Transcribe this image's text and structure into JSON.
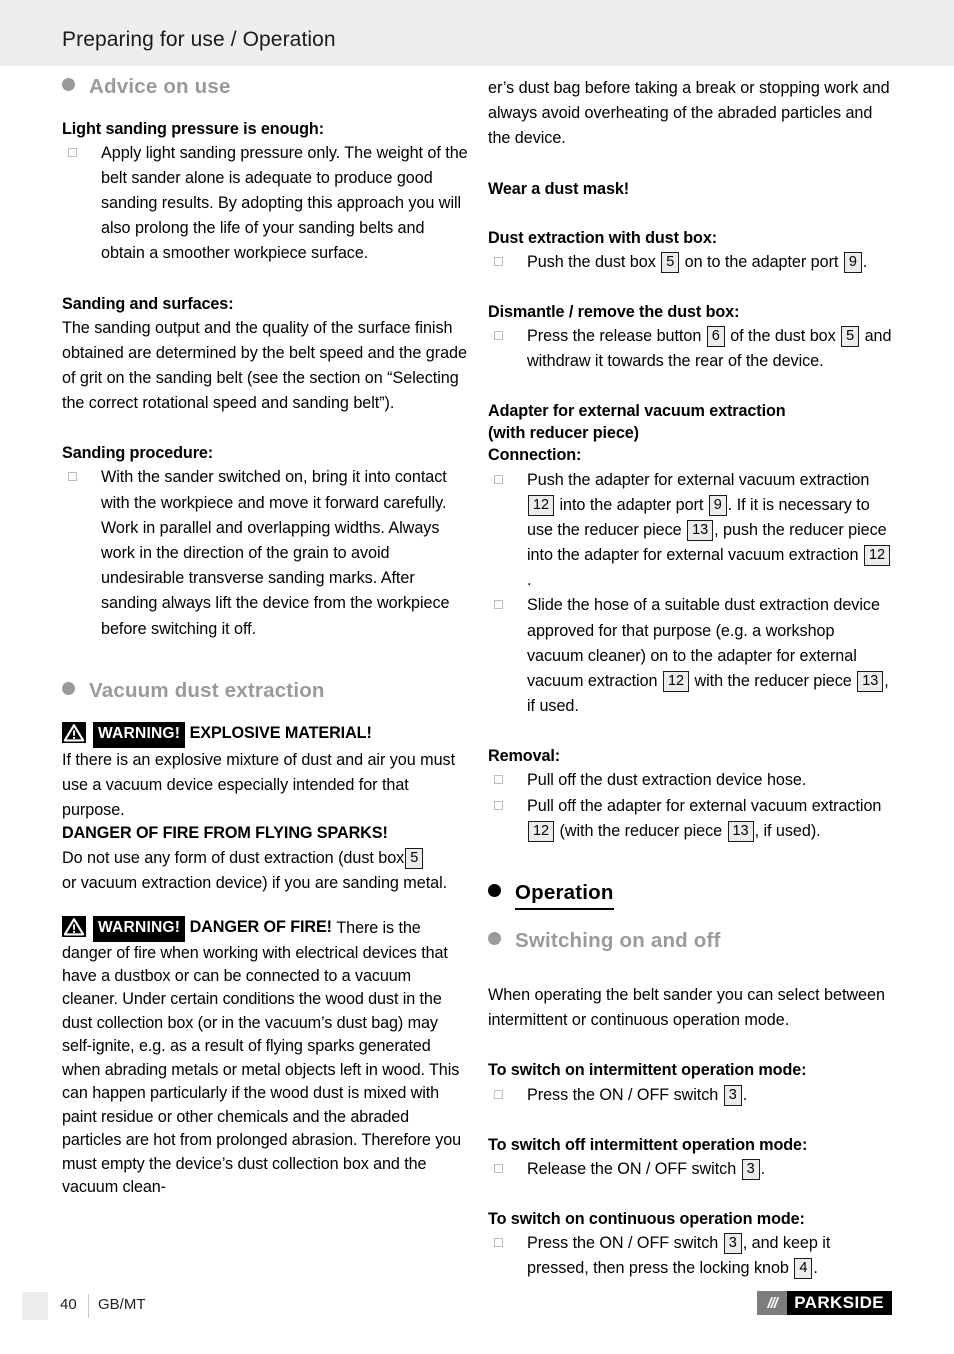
{
  "header": {
    "title": "Preparing for use / Operation"
  },
  "left_column": {
    "section_advice": {
      "title": "Advice on use",
      "bullet": "filled-circle",
      "color": "#9a9a9a"
    },
    "light_pressure": {
      "heading": "Light sanding pressure is enough:",
      "item": "Apply light sanding pressure only. The weight of the belt sander alone is adequate to produce good sanding results. By adopting this approach you will also prolong the life of your sanding belts and obtain a smoother workpiece surface."
    },
    "sanding_surfaces": {
      "heading": "Sanding and surfaces:",
      "text": "The sanding output and the quality of the surface finish obtained are determined by the belt speed and the grade of grit on the sanding belt (see the section on “Selecting the correct rotational speed and sanding belt”)."
    },
    "sanding_procedure": {
      "heading": "Sanding procedure:",
      "item": "With the sander switched on, bring it into contact with the workpiece and move it forward carefully. Work in parallel and overlapping widths. Always work in the direction of the grain to avoid undesirable transverse sanding marks. After sanding always lift the device from the workpiece before switching it off."
    },
    "section_vacuum": {
      "title": "Vacuum dust extraction",
      "bullet": "filled-circle",
      "color": "#9a9a9a"
    },
    "warning_explosive": {
      "icon": "warning-triangle",
      "tag": "WARNING!",
      "headline": "EXPLOSIVE MATERIAL!",
      "text": "If there is an explosive mixture of dust and air you must use a vacuum device especially intended for that purpose."
    },
    "danger_sparks": {
      "heading": "DANGER OF FIRE FROM FLYING SPARKS!",
      "text_a": "Do not use any form of dust extraction (dust box",
      "ref_a": "5",
      "text_b": "or vacuum extraction device) if you are sanding metal."
    },
    "warning_fire": {
      "icon": "warning-triangle",
      "tag": "WARNING!",
      "headline": "DANGER OF FIRE!",
      "text": "There is the danger of fire when working with electrical devices that have a dustbox or can be connected to a vacuum cleaner. Under certain conditions the wood dust in the dust collection box (or in the vacuum’s dust bag) may self-ignite, e.g. as a result of flying sparks generated when abrading metals or metal objects left in wood. This can happen particularly if the wood dust is mixed with paint residue or other chemicals and the abraded particles are hot from prolonged abrasion. Therefore you must empty the device’s dust collection box and the vacuum clean-"
    }
  },
  "right_column": {
    "continued_text": "er’s dust bag before taking a break or stopping work and always avoid overheating of the abraded particles and the device.",
    "dust_mask_heading": "Wear a dust mask!",
    "dust_extraction": {
      "heading": "Dust extraction with dust box:",
      "item_a": "Push the dust box",
      "ref_1": "5",
      "item_b": "on to the adapter port",
      "ref_2": "9",
      "item_c": "."
    },
    "dismantle": {
      "heading": "Dismantle / remove the dust box:",
      "item_a": "Press the release button",
      "ref_1": "6",
      "item_b": "of the dust box",
      "ref_2": "5",
      "item_c": "and withdraw it towards the rear of the device."
    },
    "adapter": {
      "heading_line1": "Adapter for external vacuum extraction",
      "heading_line2": "(with reducer piece)",
      "heading_line3": "Connection:",
      "item1_a": "Push the adapter for external vacuum extraction",
      "item1_ref1": "12",
      "item1_b": "into the adapter port",
      "item1_ref2": "9",
      "item1_c": ". If it is necessary to use the reducer piece",
      "item1_ref3": "13",
      "item1_d": ", push the reducer piece into the adapter for external vacuum extraction",
      "item1_ref4": "12",
      "item1_e": ".",
      "item2_a": "Slide the hose of a suitable dust extraction device approved for that purpose (e.g. a workshop vacuum cleaner) on to the adapter for external vacuum extraction",
      "item2_ref1": "12",
      "item2_b": "with the reducer piece",
      "item2_ref2": "13",
      "item2_c": ", if used."
    },
    "removal": {
      "heading": "Removal:",
      "item1": "Pull off the dust extraction device hose.",
      "item2_a": "Pull off the adapter for external vacuum extraction",
      "item2_ref1": "12",
      "item2_b": "(with the reducer piece",
      "item2_ref2": "13",
      "item2_c": ", if used)."
    },
    "section_operation": {
      "title": "Operation",
      "bullet": "filled-circle",
      "color": "#000000"
    },
    "section_switching": {
      "title": "Switching on and off",
      "bullet": "filled-circle",
      "color": "#9a9a9a"
    },
    "operation_intro": "When operating the belt sander you can select between intermittent or continuous operation mode.",
    "switch_on_intermittent": {
      "heading": "To switch on intermittent operation mode:",
      "item_a": "Press the ON / OFF switch",
      "ref_1": "3",
      "item_b": "."
    },
    "switch_off_intermittent": {
      "heading": "To switch off intermittent operation mode:",
      "item_a": "Release the ON / OFF switch",
      "ref_1": "3",
      "item_b": "."
    },
    "switch_on_continuous": {
      "heading": "To switch on continuous operation mode:",
      "item_a": "Press the ON / OFF switch",
      "ref_1": "3",
      "item_b": ", and keep it pressed, then press the locking knob",
      "ref_2": "4",
      "item_c": "."
    }
  },
  "footer": {
    "page_number": "40",
    "language": "GB/MT",
    "brand_slashes": "///",
    "brand_name": "PARKSIDE"
  }
}
